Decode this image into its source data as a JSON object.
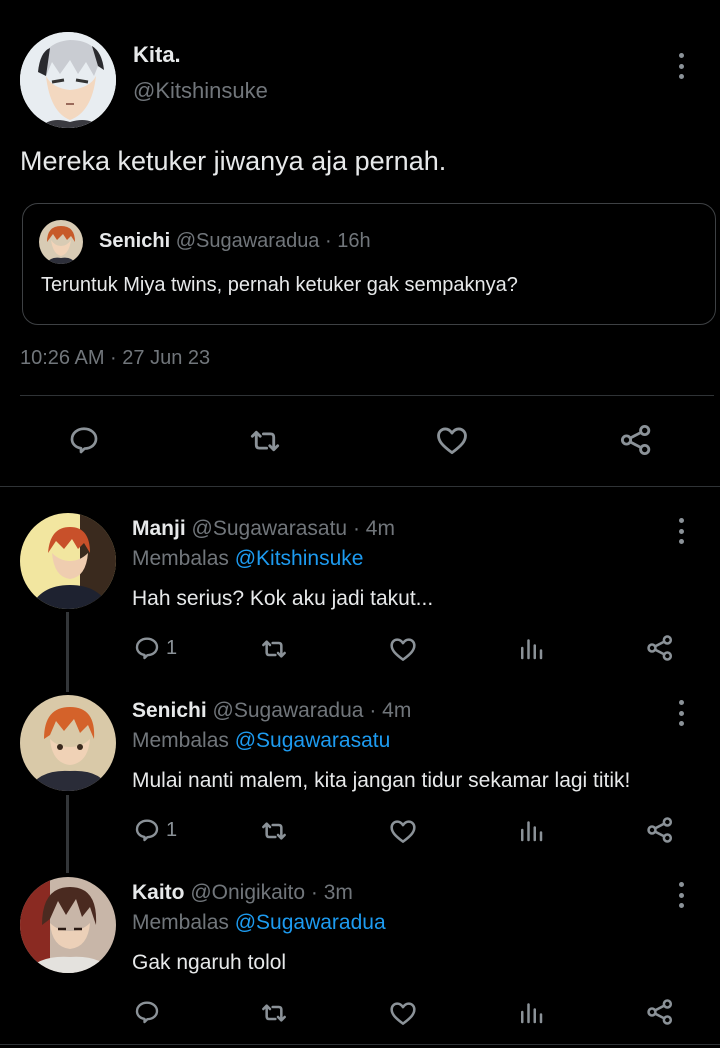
{
  "tweet": {
    "author_name": "Kita.",
    "author_handle": "@Kitshinsuke",
    "text": "Mereka ketuker jiwanya aja pernah.",
    "timestamp": "10:26 AM · 27 Jun 23",
    "quote": {
      "author_name": "Senichi",
      "author_handle": "@Sugawaradua",
      "time": "· 16h",
      "text": "Teruntuk Miya twins, pernah ketuker gak sempaknya?"
    },
    "actions": [
      "reply-icon",
      "retweet-icon",
      "like-icon",
      "share-icon"
    ]
  },
  "replies": [
    {
      "author_name": "Manji",
      "author_handle": "@Sugawarasatu",
      "time": "· 4m",
      "replying_label": "Membalas",
      "replying_to": "@Kitshinsuke",
      "text": "Hah serius? Kok aku jadi takut...",
      "reply_count": "1"
    },
    {
      "author_name": "Senichi",
      "author_handle": "@Sugawaradua",
      "time": "· 4m",
      "replying_label": "Membalas",
      "replying_to": "@Sugawarasatu",
      "text": "Mulai nanti malem, kita jangan tidur sekamar lagi titik!",
      "reply_count": "1"
    },
    {
      "author_name": "Kaito",
      "author_handle": "@Onigikaito",
      "time": "· 3m",
      "replying_label": "Membalas",
      "replying_to": "@Sugawaradua",
      "text": "Gak ngaruh tolol",
      "reply_count": ""
    }
  ],
  "colors": {
    "background": "#000000",
    "text": "#e7e9ea",
    "muted": "#71767b",
    "link": "#1d9bf0",
    "divider": "#2f3336"
  }
}
